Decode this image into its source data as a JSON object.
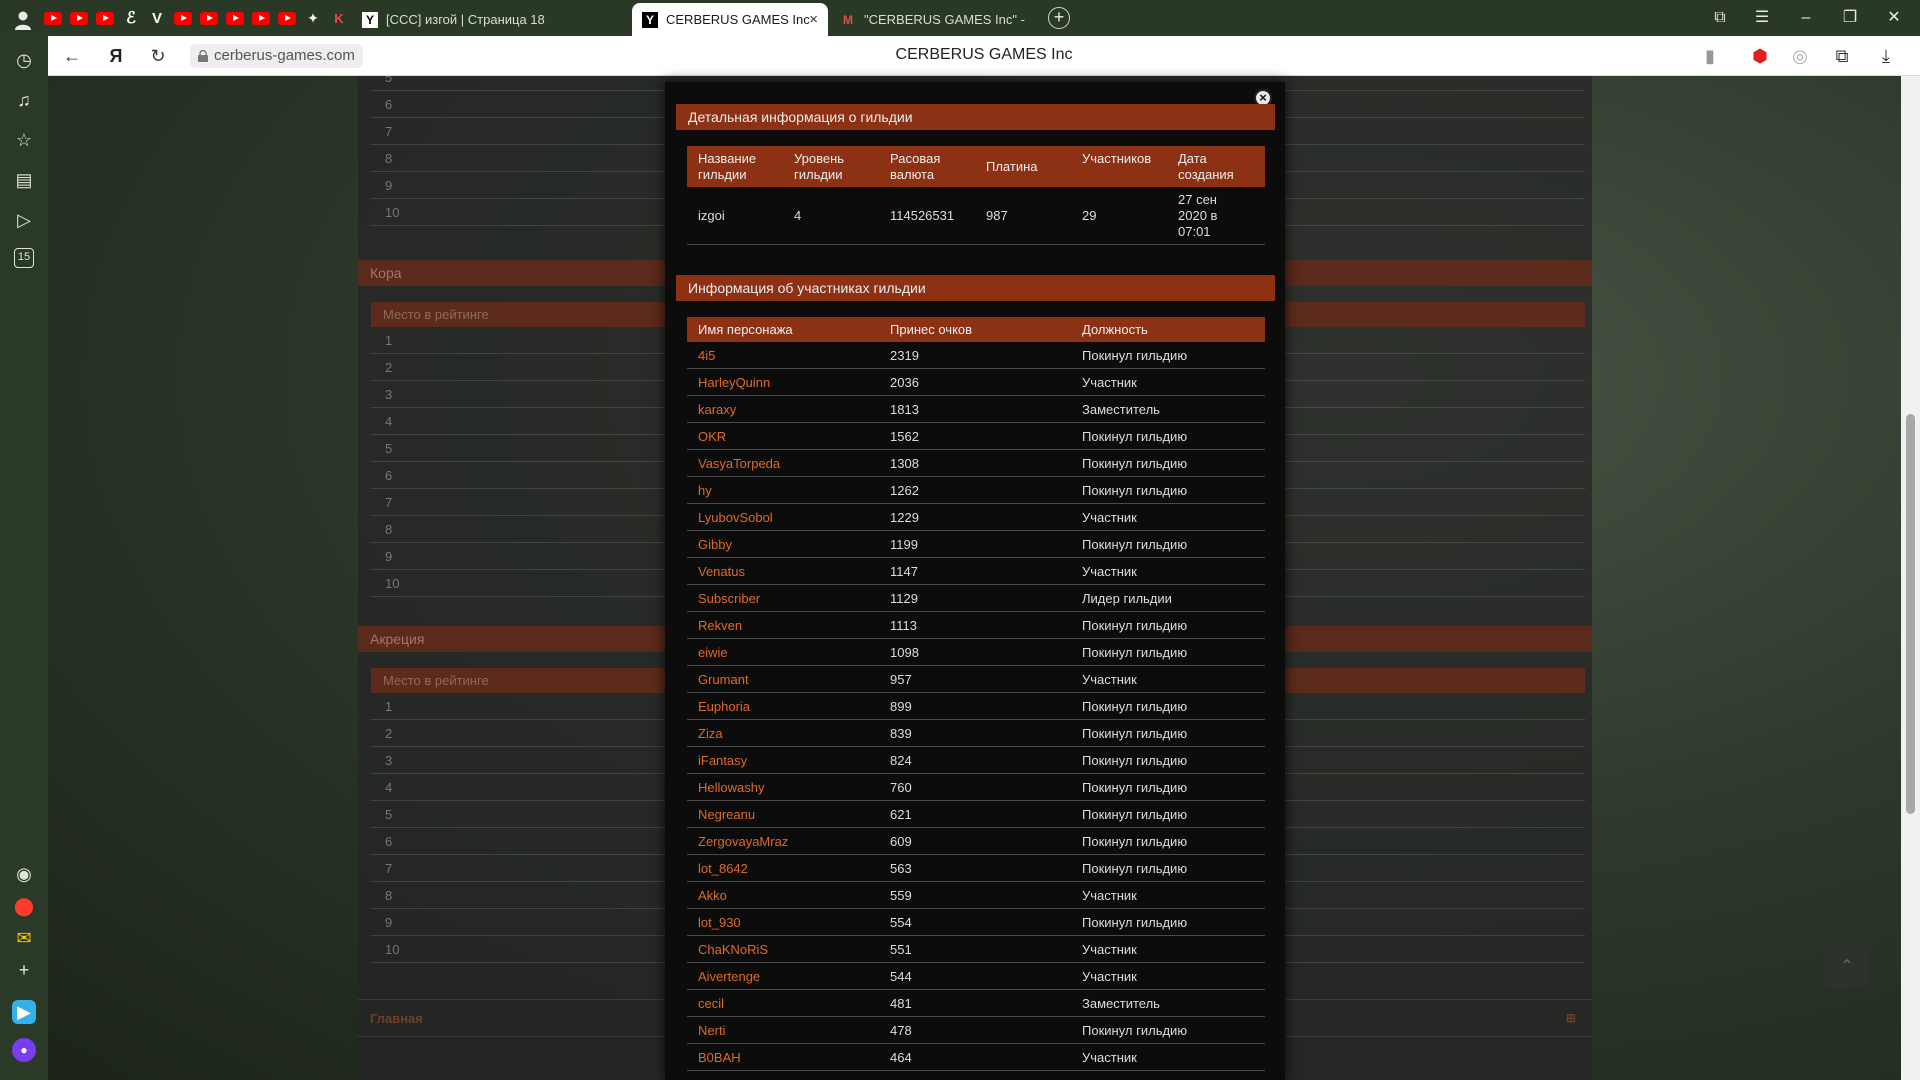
{
  "browser": {
    "tabs": [
      {
        "label": "[CCC] изгой | Страница 18",
        "favicon": "Y"
      },
      {
        "label": "CERBERUS GAMES Inc",
        "favicon": "Y"
      },
      {
        "label": "\"CERBERUS GAMES Inc\" - ",
        "favicon": "M"
      }
    ],
    "close_glyph": "×",
    "new_tab_glyph": "+",
    "url": "cerberus-games.com",
    "page_title": "CERBERUS GAMES Inc",
    "sidebar_badge": "15",
    "colors": {
      "tab_bar": "#2a3826",
      "accent_red": "#ff0000"
    }
  },
  "background_page": {
    "top_rows": [
      "5",
      "6",
      "7",
      "8",
      "9",
      "10"
    ],
    "sections": [
      {
        "title": "Кора",
        "header": "Место в рейтинге",
        "rows": [
          "1",
          "2",
          "3",
          "4",
          "5",
          "6",
          "7",
          "8",
          "9",
          "10"
        ]
      },
      {
        "title": "Акреция",
        "header": "Место в рейтинге",
        "rows": [
          "1",
          "2",
          "3",
          "4",
          "5",
          "6",
          "7",
          "8",
          "9",
          "10"
        ]
      }
    ],
    "footer_label": "Главная"
  },
  "modal": {
    "guild_section_title": "Детальная информация о гильдии",
    "guild_headers": [
      "Название гильдии",
      "Уровень гильдии",
      "Расовая валюта",
      "Платина",
      "Участников",
      "Дата создания"
    ],
    "guild_row": [
      "izgoi",
      "4",
      "114526531",
      "987",
      "29",
      "27 сен 2020 в 07:01"
    ],
    "members_section_title": "Информация об участниках гильдии",
    "members_headers": [
      "Имя персонажа",
      "Принес очков",
      "Должность"
    ],
    "members": [
      {
        "name": "4i5",
        "points": "2319",
        "role": "Покинул гильдию"
      },
      {
        "name": "HarleyQuinn",
        "points": "2036",
        "role": "Участник"
      },
      {
        "name": "karaxy",
        "points": "1813",
        "role": "Заместитель"
      },
      {
        "name": "OKR",
        "points": "1562",
        "role": "Покинул гильдию"
      },
      {
        "name": "VasyaTorpeda",
        "points": "1308",
        "role": "Покинул гильдию"
      },
      {
        "name": "hy",
        "points": "1262",
        "role": "Покинул гильдию"
      },
      {
        "name": "LyubovSobol",
        "points": "1229",
        "role": "Участник"
      },
      {
        "name": "Gibby",
        "points": "1199",
        "role": "Покинул гильдию"
      },
      {
        "name": "Venatus",
        "points": "1147",
        "role": "Участник"
      },
      {
        "name": "Subscriber",
        "points": "1129",
        "role": "Лидер гильдии"
      },
      {
        "name": "Rekven",
        "points": "1113",
        "role": "Покинул гильдию"
      },
      {
        "name": "eiwie",
        "points": "1098",
        "role": "Покинул гильдию"
      },
      {
        "name": "Grumant",
        "points": "957",
        "role": "Участник"
      },
      {
        "name": "Euphoria",
        "points": "899",
        "role": "Покинул гильдию"
      },
      {
        "name": "Ziza",
        "points": "839",
        "role": "Покинул гильдию"
      },
      {
        "name": "iFantasy",
        "points": "824",
        "role": "Покинул гильдию"
      },
      {
        "name": "Hellowashy",
        "points": "760",
        "role": "Покинул гильдию"
      },
      {
        "name": "Negreanu",
        "points": "621",
        "role": "Покинул гильдию"
      },
      {
        "name": "ZergovayaMraz",
        "points": "609",
        "role": "Покинул гильдию"
      },
      {
        "name": "lot_8642",
        "points": "563",
        "role": "Покинул гильдию"
      },
      {
        "name": "Akko",
        "points": "559",
        "role": "Участник"
      },
      {
        "name": "lot_930",
        "points": "554",
        "role": "Покинул гильдию"
      },
      {
        "name": "ChaKNoRiS",
        "points": "551",
        "role": "Участник"
      },
      {
        "name": "Aivertenge",
        "points": "544",
        "role": "Участник"
      },
      {
        "name": "cecil",
        "points": "481",
        "role": "Заместитель"
      },
      {
        "name": "Nerti",
        "points": "478",
        "role": "Покинул гильдию"
      },
      {
        "name": "B0BAH",
        "points": "464",
        "role": "Участник"
      }
    ],
    "colors": {
      "header_bg": "#8d3115",
      "name_link": "#df6a24",
      "modal_bg": "#0c0c0c"
    }
  }
}
